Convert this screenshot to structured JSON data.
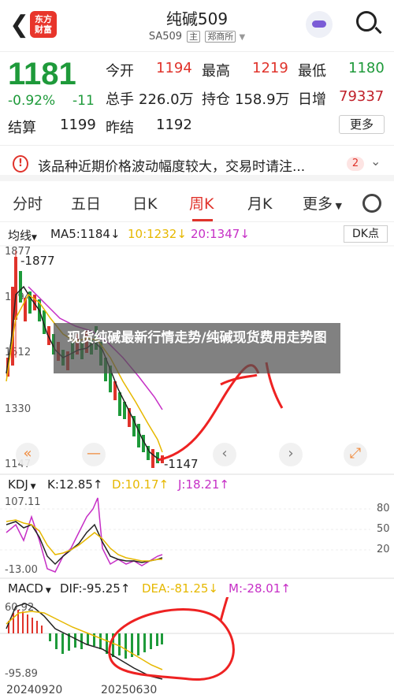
{
  "header": {
    "title": "纯碱509",
    "code": "SA509",
    "tag1": "主",
    "tag2": "郑商所",
    "logo_text": "东方\n财富",
    "back_icon": "back-arrow-icon",
    "robot_icon": "robot-icon",
    "search_icon": "search-icon"
  },
  "quote": {
    "price": "1181",
    "change_pct": "-0.92%",
    "change": "-11",
    "settle_label": "结算",
    "settle_value": "1199",
    "prev_settle_label": "昨结",
    "prev_settle_value": "1192",
    "open_label": "今开",
    "open_value": "1194",
    "high_label": "最高",
    "high_value": "1219",
    "low_label": "最低",
    "low_value": "1180",
    "volume_label": "总手",
    "volume_value": "226.0万",
    "oi_label": "持仓",
    "oi_value": "158.9万",
    "daily_inc_label": "日增",
    "daily_inc_value": "79337",
    "more_label": "更多"
  },
  "notice": {
    "text": "该品种近期价格波动幅度较大，交易时请注...",
    "count": "2"
  },
  "tabs": [
    "分时",
    "五日",
    "日K",
    "周K",
    "月K",
    "更多"
  ],
  "active_tab": "周K",
  "main_legend": {
    "type": "均线",
    "ma5": "MA5:1184↓",
    "ma10": "10:1232↓",
    "ma20": "20:1347↓",
    "dk": "DK点"
  },
  "main_axis": [
    "1877",
    "1694",
    "1512",
    "1330",
    "1147"
  ],
  "main_annotations": {
    "high": "-1877",
    "low": "-1147"
  },
  "kdj_legend": {
    "name": "KDJ",
    "k": "K:12.85↑",
    "d": "D:10.17↑",
    "j": "J:18.21↑"
  },
  "kdj_axis": {
    "top": "107.11",
    "bottom": "-13.00",
    "r80": "80",
    "r50": "50",
    "r20": "20"
  },
  "macd_legend": {
    "name": "MACD",
    "dif": "DIF:-95.25↑",
    "dea": "DEA:-81.25↓",
    "m": "M:-28.01↑"
  },
  "macd_axis": {
    "top": "60.92",
    "bottom": "-95.89"
  },
  "dates": [
    "20240920",
    "20250630"
  ],
  "overlay_text": "现货纯碱最新行情走势/纯碱现货费用走势图",
  "colors": {
    "up": "#e0332b",
    "down": "#1e9a3a",
    "ma10": "#e6b800",
    "ma20": "#c62fc6"
  }
}
